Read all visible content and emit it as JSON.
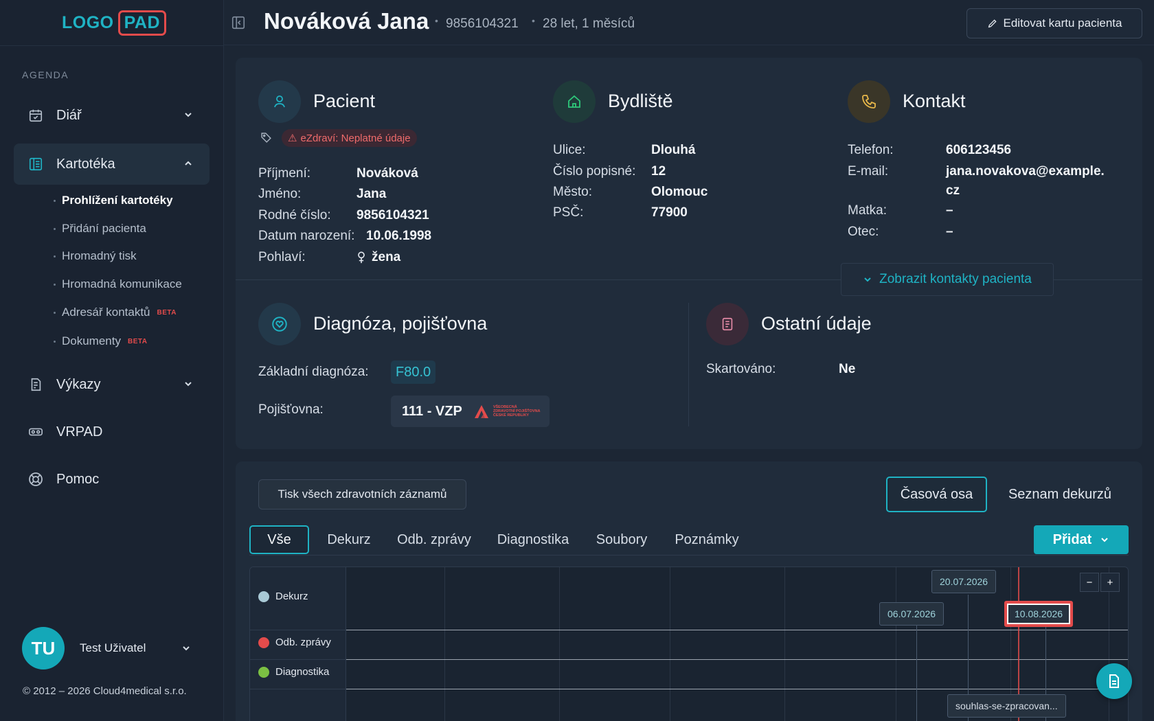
{
  "logo": {
    "part1": "LOGO",
    "part2": "PAD"
  },
  "sidebar": {
    "section_label": "AGENDA",
    "items": [
      {
        "label": "Diář",
        "icon": "calendar-icon"
      },
      {
        "label": "Kartotéka",
        "icon": "card-file-icon"
      },
      {
        "label": "Výkazy",
        "icon": "report-icon"
      },
      {
        "label": "VRPAD",
        "icon": "vr-headset-icon"
      },
      {
        "label": "Pomoc",
        "icon": "lifebuoy-icon"
      }
    ],
    "subitems": [
      {
        "label": "Prohlížení kartotéky",
        "beta": ""
      },
      {
        "label": "Přidání pacienta",
        "beta": ""
      },
      {
        "label": "Hromadný tisk",
        "beta": ""
      },
      {
        "label": "Hromadná komunikace",
        "beta": ""
      },
      {
        "label": "Adresář kontaktů",
        "beta": "BETA"
      },
      {
        "label": "Dokumenty",
        "beta": "BETA"
      }
    ],
    "user": {
      "initials": "TU",
      "name": "Test Uživatel"
    },
    "copyright": "© 2012 – 2026 Cloud4medical s.r.o."
  },
  "header": {
    "patient_name": "Nováková Jana",
    "rodne_cislo": "9856104321",
    "age": "28 let, 1 měsíců",
    "edit_label": "Editovat kartu pacienta"
  },
  "patient": {
    "title": "Pacient",
    "badge": "eZdraví: Neplatné údaje",
    "rows": [
      {
        "label": "Příjmení:",
        "value": "Nováková"
      },
      {
        "label": "Jméno:",
        "value": "Jana"
      },
      {
        "label": "Rodné číslo:",
        "value": "9856104321"
      },
      {
        "label": "Datum narození:",
        "value": "10.06.1998"
      },
      {
        "label": "Pohlaví:",
        "value": "žena"
      }
    ]
  },
  "address": {
    "title": "Bydliště",
    "rows": [
      {
        "label": "Ulice:",
        "value": "Dlouhá"
      },
      {
        "label": "Číslo popisné:",
        "value": "12"
      },
      {
        "label": "Město:",
        "value": "Olomouc"
      },
      {
        "label": "PSČ:",
        "value": "77900"
      }
    ]
  },
  "contact": {
    "title": "Kontakt",
    "phone_label": "Telefon:",
    "phone": "606123456",
    "email_label": "E-mail:",
    "email_line1": "jana.novakova@example.",
    "email_line2": "cz",
    "mother_label": "Matka:",
    "mother": "–",
    "father_label": "Otec:",
    "father": "–",
    "show_contacts": "Zobrazit kontakty pacienta"
  },
  "diagnosis": {
    "title": "Diagnóza, pojišťovna",
    "diag_label": "Základní diagnóza:",
    "diag_value": "F80.0",
    "insurer_label": "Pojišťovna:",
    "insurer_value": "111 - VZP",
    "insurer_logo_text": [
      "VŠEOBECNÁ",
      "ZDRAVOTNÍ POJIŠŤOVNA",
      "ČESKÉ REPUBLIKY"
    ]
  },
  "other": {
    "title": "Ostatní údaje",
    "shred_label": "Skartováno:",
    "shred_value": "Ne"
  },
  "records": {
    "print_all": "Tisk všech zdravotních záznamů",
    "view_timeline": "Časová osa",
    "view_list": "Seznam dekurzů",
    "tabs": [
      "Vše",
      "Dekurz",
      "Odb. zprávy",
      "Diagnostika",
      "Soubory",
      "Poznámky"
    ],
    "add_label": "Přidat"
  },
  "timeline": {
    "rows": [
      {
        "label": "Dekurz",
        "color": "#a9c9d6"
      },
      {
        "label": "Odb. zprávy",
        "color": "#e34b4b"
      },
      {
        "label": "Diagnostika",
        "color": "#7bc043"
      }
    ],
    "events": [
      {
        "date": "20.07.2026"
      },
      {
        "date": "06.07.2026"
      },
      {
        "date": "10.08.2026",
        "selected": true
      }
    ],
    "file_label": "souhlas-se-zpracovan...",
    "zoom_out": "−",
    "zoom_in": "+"
  },
  "colors": {
    "accent": "#14a8b8",
    "danger": "#e34b4b",
    "background": "#1c2634",
    "card": "#202c3b"
  }
}
